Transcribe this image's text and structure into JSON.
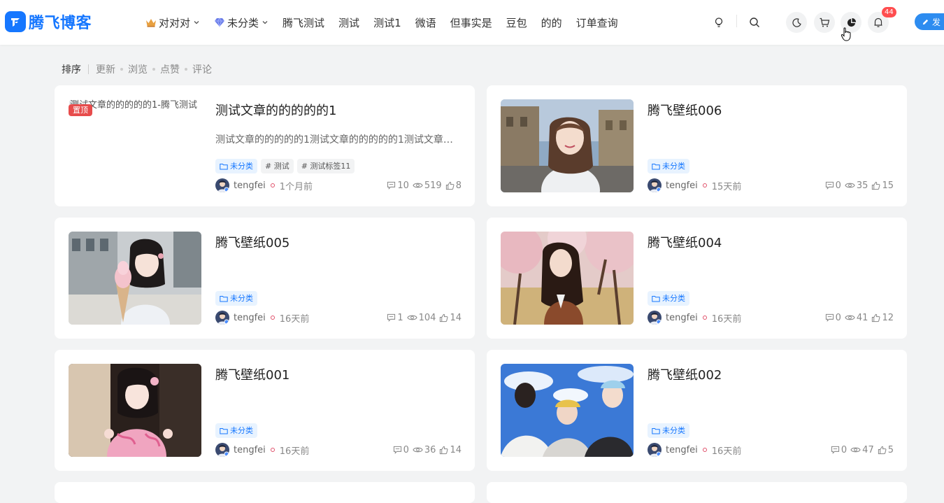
{
  "brand": {
    "name": "腾飞博客",
    "accent": "#1677ff"
  },
  "nav": [
    {
      "label": "对对对",
      "pre_icon": "crown-icon",
      "dropdown": true
    },
    {
      "label": "未分类",
      "pre_icon": "diamond-icon",
      "dropdown": true
    },
    {
      "label": "腾飞测试"
    },
    {
      "label": "测试"
    },
    {
      "label": "测试1"
    },
    {
      "label": "微语"
    },
    {
      "label": "但事实是"
    },
    {
      "label": "豆包"
    },
    {
      "label": "的的"
    },
    {
      "label": "订单查询"
    }
  ],
  "header_actions": {
    "notification_count": "44",
    "publish_label": "发"
  },
  "sort": {
    "label": "排序",
    "options": [
      "更新",
      "浏览",
      "点赞",
      "评论"
    ]
  },
  "posts": [
    {
      "title": "测试文章的的的的的1",
      "excerpt": "测试文章的的的的的1测试文章的的的的的1测试文章的的的的的1",
      "image_alt": "测试文章的的的的的1-腾飞测试",
      "pinned_label": "置顶",
      "tags": [
        {
          "label": "未分类",
          "type": "category"
        },
        {
          "label": "# 测试",
          "type": "tag"
        },
        {
          "label": "# 测试标签11",
          "type": "tag"
        }
      ],
      "author": "tengfei",
      "time": "1个月前",
      "comments": "10",
      "views": "519",
      "likes": "8"
    },
    {
      "title": "腾飞壁纸006",
      "tags": [
        {
          "label": "未分类",
          "type": "category"
        }
      ],
      "author": "tengfei",
      "time": "15天前",
      "comments": "0",
      "views": "35",
      "likes": "15"
    },
    {
      "title": "腾飞壁纸005",
      "tags": [
        {
          "label": "未分类",
          "type": "category"
        }
      ],
      "author": "tengfei",
      "time": "16天前",
      "comments": "1",
      "views": "104",
      "likes": "14"
    },
    {
      "title": "腾飞壁纸004",
      "tags": [
        {
          "label": "未分类",
          "type": "category"
        }
      ],
      "author": "tengfei",
      "time": "16天前",
      "comments": "0",
      "views": "41",
      "likes": "12"
    },
    {
      "title": "腾飞壁纸001",
      "tags": [
        {
          "label": "未分类",
          "type": "category"
        }
      ],
      "author": "tengfei",
      "time": "16天前",
      "comments": "0",
      "views": "36",
      "likes": "14"
    },
    {
      "title": "腾飞壁纸002",
      "tags": [
        {
          "label": "未分类",
          "type": "category"
        }
      ],
      "author": "tengfei",
      "time": "16天前",
      "comments": "0",
      "views": "47",
      "likes": "5"
    }
  ]
}
